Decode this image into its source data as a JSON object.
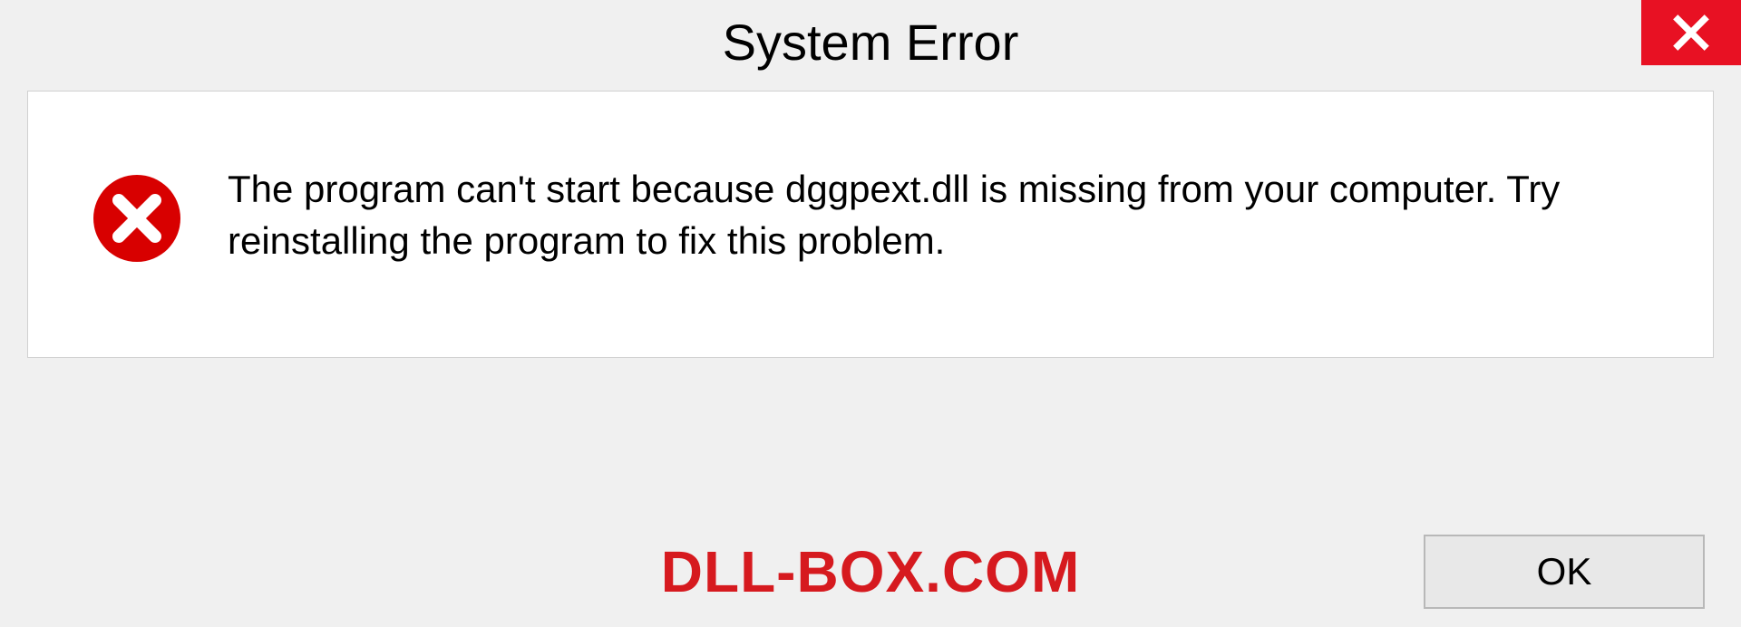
{
  "dialog": {
    "title": "System Error",
    "message": "The program can't start because dggpext.dll is missing from your computer. Try reinstalling the program to fix this problem.",
    "ok_label": "OK"
  },
  "watermark": "DLL-BOX.COM",
  "colors": {
    "close_bg": "#e81123",
    "error_icon": "#d80000",
    "watermark": "#d61a1f"
  }
}
